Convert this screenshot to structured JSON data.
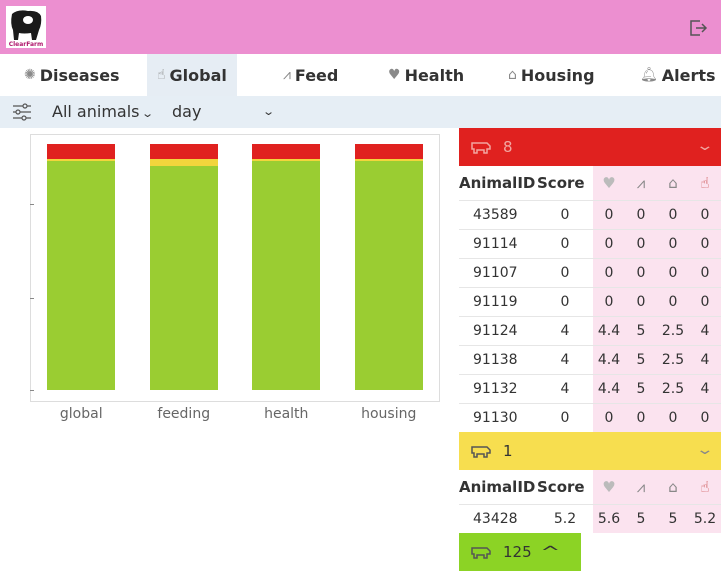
{
  "header": {
    "logo_text": "ClearFarm",
    "brand_color": "#ec8fd0"
  },
  "nav": {
    "tabs": [
      {
        "label": "Diseases",
        "icon": "virus-icon",
        "active": false
      },
      {
        "label": "Global",
        "icon": "hand-icon",
        "active": true
      },
      {
        "label": "Feed",
        "icon": "grass-icon",
        "active": false
      },
      {
        "label": "Health",
        "icon": "heart-icon",
        "active": false
      },
      {
        "label": "Housing",
        "icon": "house-icon",
        "active": false
      },
      {
        "label": "Alerts",
        "icon": "bell-icon",
        "active": false
      }
    ]
  },
  "toolbar": {
    "animals_select": "All animals",
    "period_select": "day"
  },
  "chart_data": {
    "type": "bar",
    "stacked": true,
    "categories": [
      "global",
      "feeding",
      "health",
      "housing"
    ],
    "series": [
      {
        "color": "#9acd32",
        "values": [
          0.93,
          0.91,
          0.93,
          0.93
        ]
      },
      {
        "color": "#f2d53c",
        "values": [
          0.01,
          0.03,
          0.01,
          0.01
        ]
      },
      {
        "color": "#e0211f",
        "values": [
          0.06,
          0.06,
          0.06,
          0.06
        ]
      }
    ],
    "ylim": [
      0,
      1
    ],
    "grid": false
  },
  "panel": {
    "groups": [
      {
        "count": "8",
        "color": "#e0211f",
        "headers": [
          "AnimalID",
          "Score"
        ],
        "rows": [
          [
            "43589",
            "0",
            "0",
            "0",
            "0",
            "0"
          ],
          [
            "91114",
            "0",
            "0",
            "0",
            "0",
            "0"
          ],
          [
            "91107",
            "0",
            "0",
            "0",
            "0",
            "0"
          ],
          [
            "91119",
            "0",
            "0",
            "0",
            "0",
            "0"
          ],
          [
            "91124",
            "4",
            "4.4",
            "5",
            "2.5",
            "4"
          ],
          [
            "91138",
            "4",
            "4.4",
            "5",
            "2.5",
            "4"
          ],
          [
            "91132",
            "4",
            "4.4",
            "5",
            "2.5",
            "4"
          ],
          [
            "91130",
            "0",
            "0",
            "0",
            "0",
            "0"
          ]
        ]
      },
      {
        "count": "1",
        "color": "#f7de4f",
        "headers": [
          "AnimalID",
          "Score"
        ],
        "rows": [
          [
            "43428",
            "5.2",
            "5.6",
            "5",
            "5",
            "5.2"
          ]
        ]
      },
      {
        "count": "125",
        "color": "#8cd325"
      }
    ]
  }
}
